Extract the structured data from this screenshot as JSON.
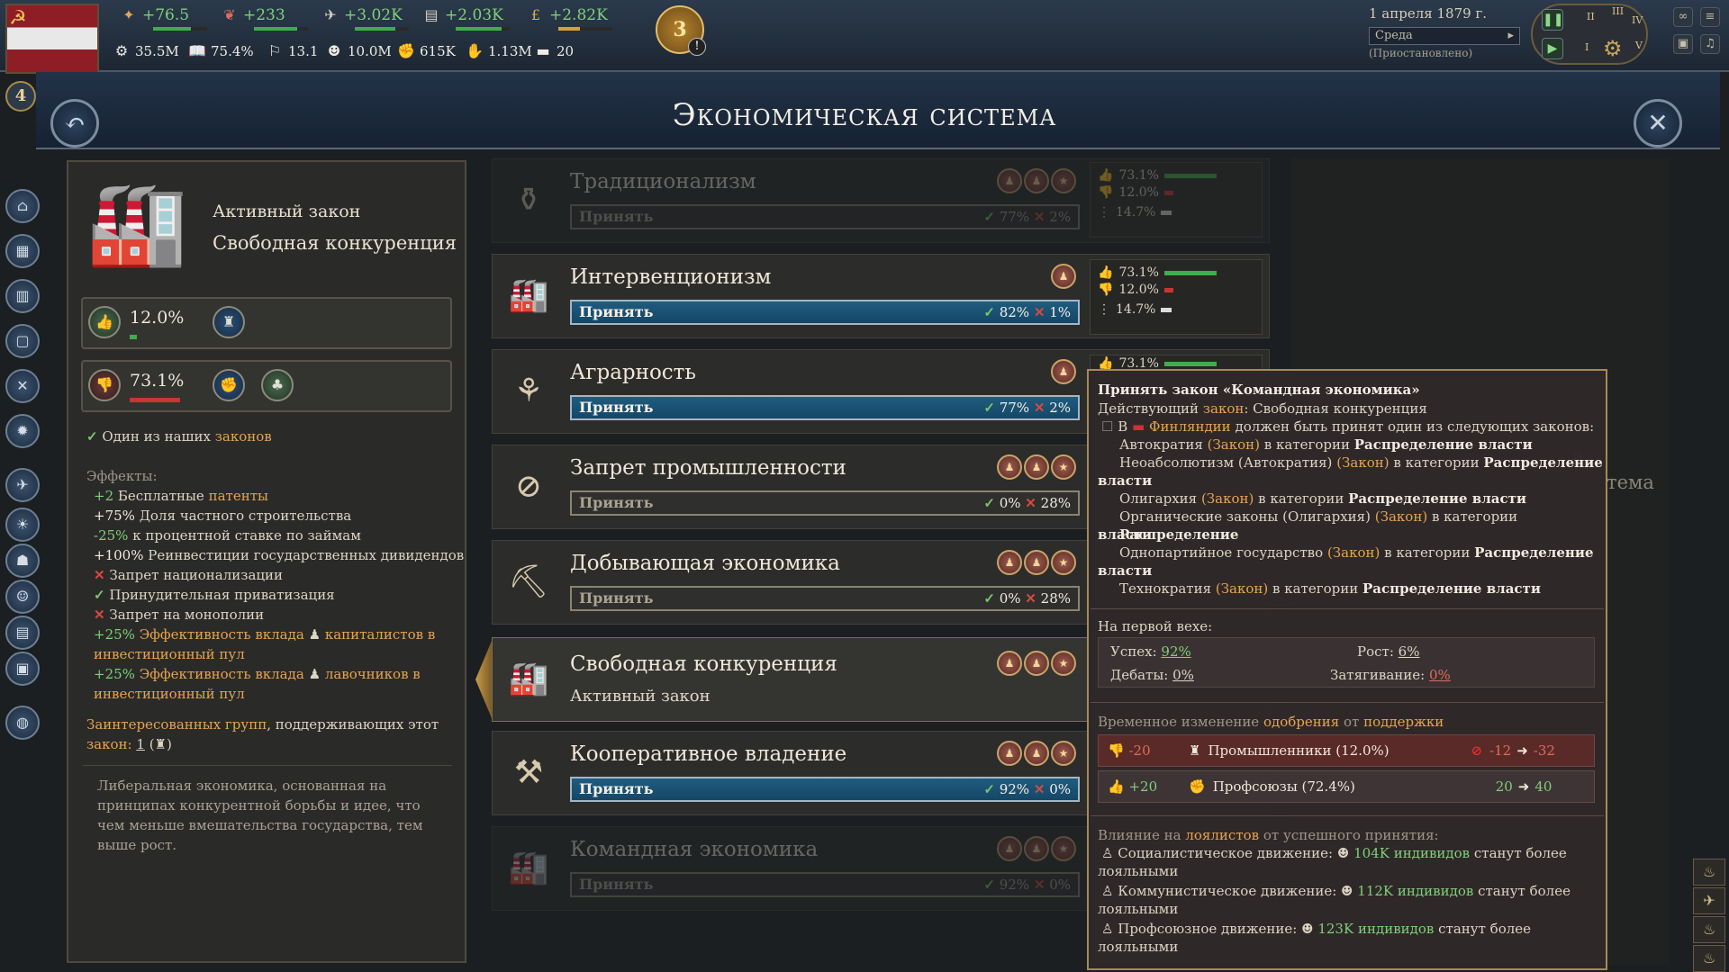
{
  "topbar": {
    "stats_top": [
      {
        "icon": "authority-icon",
        "value": "+76.5"
      },
      {
        "icon": "influence-icon",
        "value": "+233"
      },
      {
        "icon": "innovation-icon",
        "value": "+3.02K"
      },
      {
        "icon": "bureaucracy-icon",
        "value": "+2.03K"
      },
      {
        "icon": "pound-icon",
        "value": "+2.82K"
      }
    ],
    "stats_bottom": [
      {
        "icon": "gdp-icon",
        "value": "35.5M"
      },
      {
        "icon": "literacy-icon",
        "value": "75.4%"
      },
      {
        "icon": "sol-icon",
        "value": "13.1"
      },
      {
        "icon": "population-icon",
        "value": "10.0M"
      },
      {
        "icon": "army-icon",
        "value": "615K"
      },
      {
        "icon": "peasants-icon",
        "value": "1.13M"
      },
      {
        "icon": "ships-icon",
        "value": "20"
      }
    ],
    "journal_count": "3",
    "journal_alert": "!",
    "date": "1 апреля 1879 г.",
    "weekday": "Среда",
    "status": "(Приостановлено)",
    "speed_numerals": [
      "I",
      "II",
      "III",
      "IV",
      "V"
    ],
    "rank": "4"
  },
  "title": "Экономическая система",
  "left": {
    "active_label": "Активный закон",
    "active_name": "Свободная конкуренция",
    "support_pct": "12.0%",
    "oppose_pct": "73.1%",
    "ours_check": "✓",
    "ours_text_1": "Один из наших",
    "ours_text_2": "законов",
    "effects_title": "Эффекты:",
    "effects": [
      {
        "prefix": "+2",
        "text": "Бесплатные",
        "link": "патенты"
      },
      {
        "prefix": "+75%",
        "text": "Доля частного строительства"
      },
      {
        "prefix": "-25%",
        "text": "к процентной ставке по займам"
      },
      {
        "prefix": "+100%",
        "text": "Реинвестиции государственных дивидендов"
      },
      {
        "mark": "✕",
        "text": "Запрет национализации"
      },
      {
        "mark": "✓",
        "text": "Принудительная приватизация"
      },
      {
        "mark": "✕",
        "text": "Запрет на монополии"
      },
      {
        "prefix": "+25%",
        "text": "Эффективность вклада",
        "tail": "капиталистов в",
        "tail2": "инвестиционный пул"
      },
      {
        "prefix": "+25%",
        "text": "Эффективность вклада",
        "tail": "лавочников в",
        "tail2": "инвестиционный пул"
      }
    ],
    "interest_1": "Заинтересованных групп",
    "interest_2": ", поддерживающих этот",
    "interest_3": "закон:",
    "interest_count": "1",
    "description": "Либеральная экономика, основанная на принципах конкурентной борьбы и идее, что чем меньше вмешательства государства, тем выше рост."
  },
  "laws": [
    {
      "name": "Традиционализм",
      "button": "Принять",
      "yes": "77%",
      "no": "2%"
    },
    {
      "name": "Интервенционизм",
      "button": "Принять",
      "yes": "82%",
      "no": "1%"
    },
    {
      "name": "Аграрность",
      "button": "Принять",
      "yes": "77%",
      "no": "2%"
    },
    {
      "name": "Запрет промышленности",
      "button": "Принять",
      "yes": "0%",
      "no": "28%"
    },
    {
      "name": "Добывающая экономика",
      "button": "Принять",
      "yes": "0%",
      "no": "28%"
    },
    {
      "name": "Свободная конкуренция",
      "active_text": "Активный закон"
    },
    {
      "name": "Кооперативное владение",
      "button": "Принять",
      "yes": "92%",
      "no": "0%"
    },
    {
      "name": "Командная экономика",
      "button": "Принять",
      "yes": "92%",
      "no": "0%"
    }
  ],
  "approval": [
    {
      "values": [
        "73.1%",
        "12.0%",
        "14.7%"
      ]
    },
    {
      "values": [
        "73.1%",
        "12.0%",
        "14.7%"
      ]
    },
    {
      "values": [
        "73.1%"
      ]
    }
  ],
  "approval_shares": [
    0.731,
    0.12,
    0.147
  ],
  "rightpane": {
    "fragment_1": "в",
    "fragment_2": "тема"
  },
  "tooltip": {
    "title": "Принять закон «Командная экономика»",
    "current_prefix": "Действующий",
    "current_link": "закон",
    "current_value": ": Свободная конкуренция",
    "req_in": "В",
    "req_country": "Финляндии",
    "req_text": "должен быть принят один из следующих законов:",
    "reqs": [
      {
        "law": "Автократия",
        "tag": "(Закон)",
        "mid": "в категории",
        "cat": "Распределение власти"
      },
      {
        "law": "Неоабсолютизм (Автократия)",
        "tag": "(Закон)",
        "mid": "в категории",
        "cat": "Распределение",
        "cat2": "власти"
      },
      {
        "law": "Олигархия",
        "tag": "(Закон)",
        "mid": "в категории",
        "cat": "Распределение власти"
      },
      {
        "law": "Органические законы (Олигархия)",
        "tag": "(Закон)",
        "mid": "в категории",
        "cat": "Распределение",
        "cat2": "власти"
      },
      {
        "law": "Однопартийное государство",
        "tag": "(Закон)",
        "mid": "в категории",
        "cat": "Распределение",
        "cat2": "власти"
      },
      {
        "law": "Технократия",
        "tag": "(Закон)",
        "mid": "в категории",
        "cat": "Распределение власти"
      }
    ],
    "stage_title": "На первой вехе:",
    "success_label": "Успех:",
    "success_value": "92%",
    "growth_label": "Рост:",
    "growth_value": "6%",
    "debate_label": "Дебаты:",
    "debate_value": "0%",
    "stall_label": "Затягивание:",
    "stall_value": "0%",
    "approval_title_1": "Временное изменение",
    "approval_title_2": "одобрения",
    "approval_title_3": "от",
    "approval_title_4": "поддержки",
    "groups": [
      {
        "delta": "-20",
        "name": "Промышленники (12.0%)",
        "from": "-12",
        "to": "-32"
      },
      {
        "delta": "+20",
        "name": "Профсоюзы (72.4%)",
        "from": "20",
        "to": "40"
      }
    ],
    "loyal_title_1": "Влияние на",
    "loyal_title_2": "лоялистов",
    "loyal_title_3": "от успешного принятия:",
    "loyal": [
      {
        "movement": "Социалистическое движение:",
        "count": "104K",
        "word": "индивидов",
        "tail": "станут более",
        "tail2": "лояльными"
      },
      {
        "movement": "Коммунистическое движение:",
        "count": "112K",
        "word": "индивидов",
        "tail": "станут более",
        "tail2": "лояльными"
      },
      {
        "movement": "Профсоюзное движение:",
        "count": "123K",
        "word": "индивидов",
        "tail": "станут более",
        "tail2": "лояльными"
      }
    ]
  },
  "colors": {
    "accent_gold": "#c89c4a",
    "button_blue": "#1f5c80",
    "approve_green": "#3fae4a",
    "oppose_red": "#c33",
    "tooltip_bg": "#302828"
  }
}
